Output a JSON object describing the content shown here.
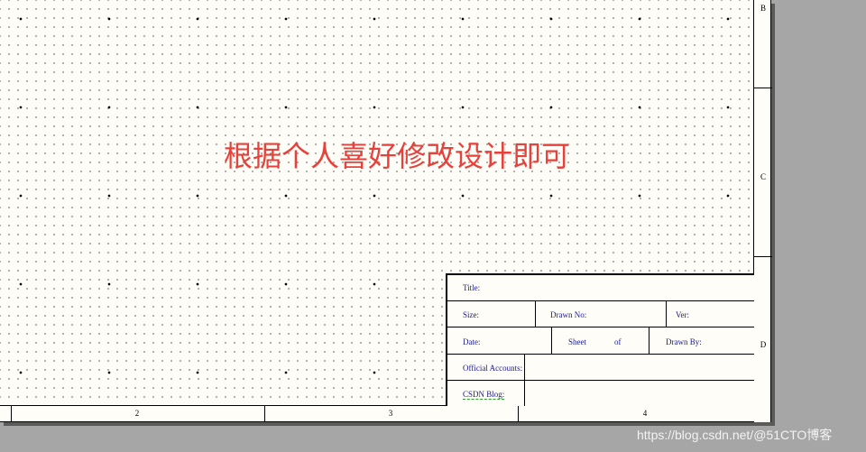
{
  "annotation": {
    "text": "根据个人喜好修改设计即可",
    "color": "#e8403a"
  },
  "border_zones": {
    "rows": [
      "B",
      "C",
      "D"
    ],
    "columns": [
      "2",
      "3",
      "4"
    ]
  },
  "title_block": {
    "title_label": "Title:",
    "size_label": "Size:",
    "drawn_no_label": "Drawn No:",
    "ver_label": "Ver:",
    "date_label": "Date:",
    "sheet_label": "Sheet",
    "of_label": "of",
    "drawn_by_label": "Drawn By:",
    "official_accounts_label": "Official Accounts:",
    "csdn_blog_label": "CSDN Blog:",
    "label_color": "#1a1a8c"
  },
  "watermark": {
    "text": "https://blog.csdn.net/@51CTO博客"
  }
}
